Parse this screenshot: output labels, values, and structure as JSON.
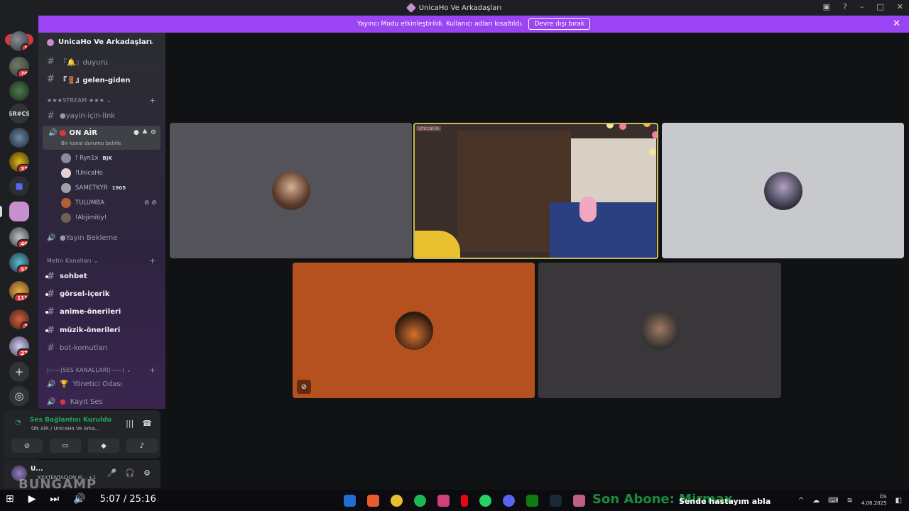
{
  "window": {
    "title": "UnicaHo Ve Arkadaşları"
  },
  "notice": {
    "text": "Yayıncı Modu etkinleştirildi. Kullanıcı adları kısaltıldı.",
    "button": "Devre dışı bırak"
  },
  "servers": {
    "new_badge": "YENİ",
    "badges": [
      "1",
      "70",
      "33",
      "40",
      "53",
      "111",
      "3",
      "27"
    ],
    "text_icon": "SR#CS"
  },
  "sidebar": {
    "server_name": "UnicaHo Ve Arkadaşları",
    "channels_top": [
      {
        "name": "『🔔』duyuru"
      },
      {
        "name": "『🚪』gelen-giden"
      }
    ],
    "stream_category": "★★★STREAM ★★★",
    "yayin_link": "●yayin-için-link",
    "on_air": {
      "name": "ON AİR",
      "status": "Bir kanal durumu belirle"
    },
    "voice_users": [
      {
        "name": "! Ryn1x",
        "tag": "BJK"
      },
      {
        "name": "!UnicaHo",
        "tag": ""
      },
      {
        "name": "SAMETKYR",
        "tag": "1905"
      },
      {
        "name": "TULUMBA",
        "tag": ""
      },
      {
        "name": "!Abjimitiy!",
        "tag": ""
      }
    ],
    "yayin_bekleme": "●Yayın Bekleme",
    "text_category": "Metin Kanalları",
    "text_channels": [
      {
        "name": "sohbet"
      },
      {
        "name": "görsel-içerik"
      },
      {
        "name": "anime-önerileri"
      },
      {
        "name": "müzik-önerileri"
      },
      {
        "name": "bot-komutları"
      }
    ],
    "voice_category": "|——|SES KANALLARI|——|",
    "voice_channels": [
      {
        "name": "Yönetici Odası"
      },
      {
        "name": "Kayıt Ses"
      }
    ]
  },
  "voice_panel": {
    "status": "Ses Bağlantısı Kuruldu",
    "location": "ON AİR / UnicaHo Ve Arka..."
  },
  "user_panel": {
    "name": "U...",
    "status": "XXXTENTACION di... +1"
  },
  "stage": {
    "camera_tag": "UnicaHo"
  },
  "taskbar": {
    "time": "5:07 / 25:16",
    "song": "Son Abone: Mirmax",
    "song2": "Sende hastayım abla",
    "clock_time": "ÖS",
    "clock_date": "4.08.2025"
  },
  "watermark": "BUNGAMP",
  "colors": {
    "accent": "#9b44f3",
    "connected": "#23a55a",
    "danger": "#da373c"
  }
}
